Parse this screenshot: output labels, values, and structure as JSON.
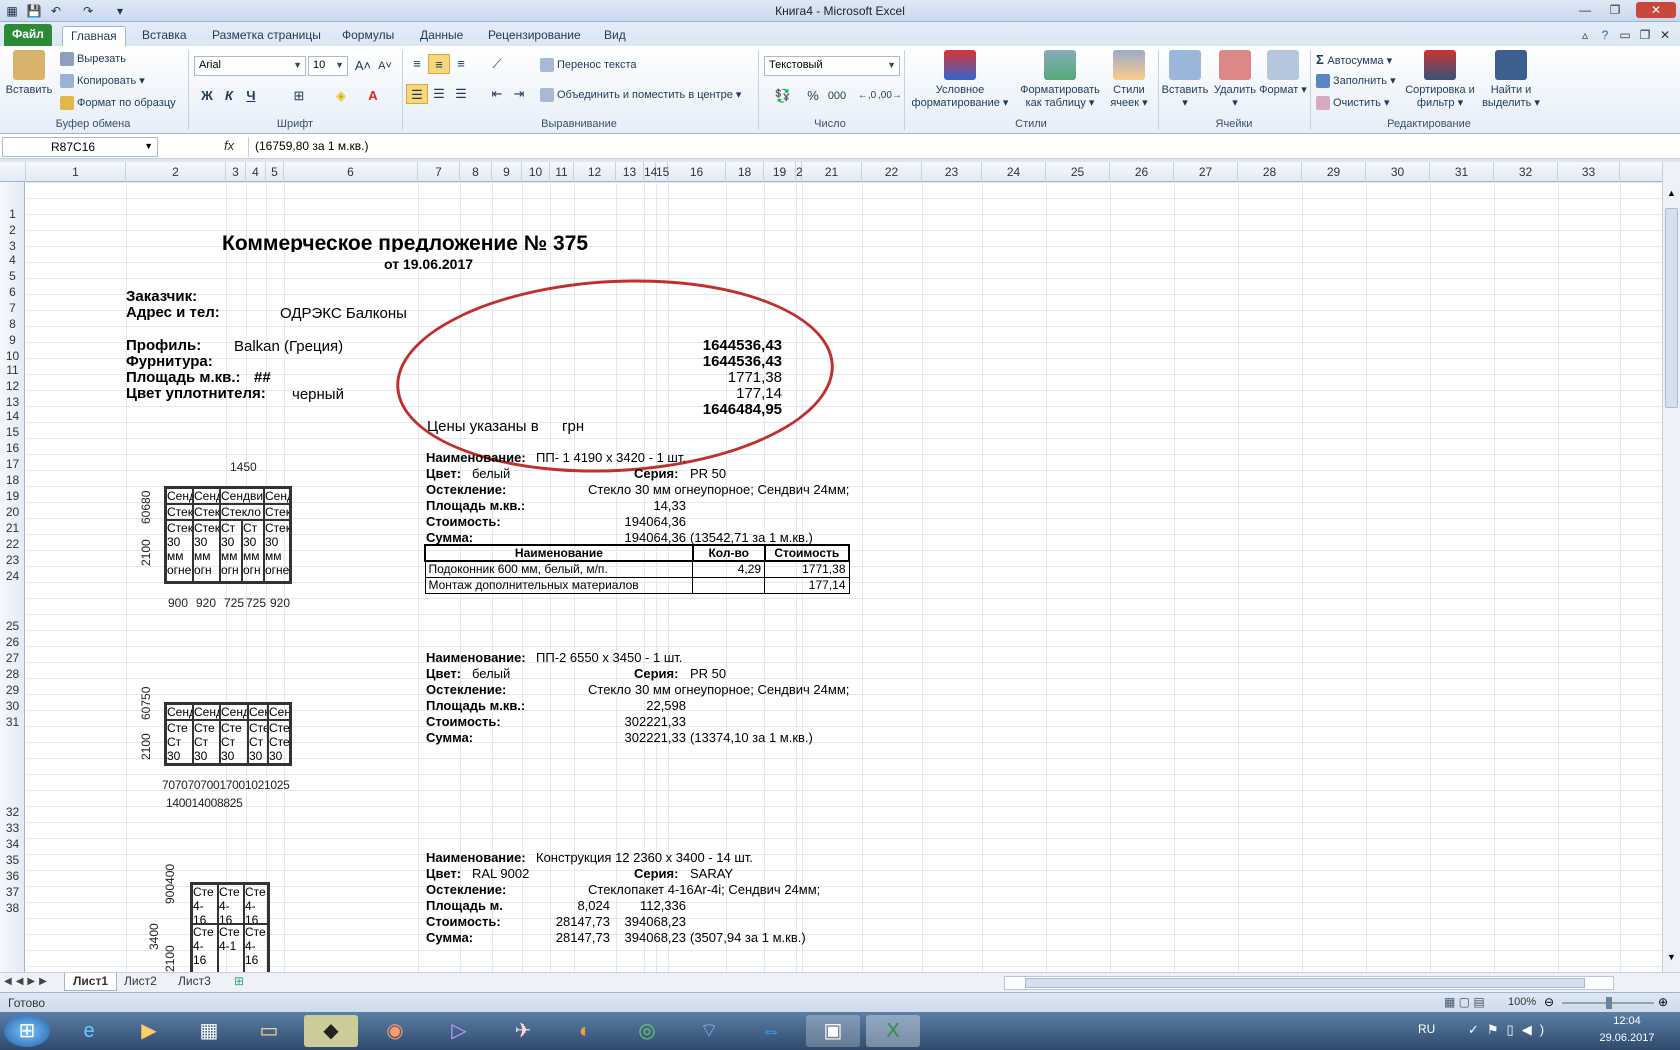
{
  "window": {
    "title": "Книга4  -  Microsoft Excel",
    "qat": [
      "save-icon",
      "undo-icon",
      "redo-icon",
      "customize-icon"
    ]
  },
  "tabs": [
    "Файл",
    "Главная",
    "Вставка",
    "Разметка страницы",
    "Формулы",
    "Данные",
    "Рецензирование",
    "Вид"
  ],
  "ribbon": {
    "clipboard": {
      "paste": "Вставить",
      "cut": "Вырезать",
      "copy": "Копировать",
      "format_painter": "Формат по образцу",
      "label": "Буфер обмена"
    },
    "font": {
      "name": "Arial",
      "size": "10",
      "label": "Шрифт",
      "bold": "Ж",
      "italic": "К",
      "underline": "Ч"
    },
    "alignment": {
      "wrap": "Перенос текста",
      "merge": "Объединить и поместить в центре",
      "label": "Выравнивание"
    },
    "number": {
      "format": "Текстовый",
      "label": "Число",
      "percent": "%",
      "thousands": "000"
    },
    "styles": {
      "cond": "Условное форматирование",
      "table": "Форматировать как таблицу",
      "cell": "Стили ячеек",
      "label": "Стили"
    },
    "cells": {
      "insert": "Вставить",
      "delete": "Удалить",
      "format": "Формат",
      "label": "Ячейки"
    },
    "editing": {
      "autosum": "Автосумма",
      "fill": "Заполнить",
      "clear": "Очистить",
      "sort": "Сортировка и фильтр",
      "find": "Найти и выделить",
      "label": "Редактирование"
    }
  },
  "formula_bar": {
    "name_box": "R87C16",
    "fx": "fx",
    "formula": "(16759,80 за 1 м.кв.)"
  },
  "columns": [
    "1",
    "2",
    "3",
    "4",
    "5",
    "6",
    "7",
    "8",
    "9",
    "10",
    "11",
    "12",
    "13",
    "14",
    "15",
    "16",
    "18",
    "19",
    "2",
    "21",
    "22",
    "23",
    "24",
    "25",
    "26",
    "27",
    "28",
    "29",
    "30",
    "31",
    "32",
    "33"
  ],
  "rows": [
    "1",
    "2",
    "3",
    "4",
    "5",
    "6",
    "7",
    "8",
    "9",
    "10",
    "11",
    "12",
    "13",
    "14",
    "15",
    "16",
    "17",
    "18",
    "19",
    "20",
    "21",
    "22",
    "23",
    "24",
    "25",
    "26",
    "27",
    "28",
    "29",
    "30",
    "31",
    "32",
    "33",
    "34",
    "35",
    "36",
    "37",
    "38"
  ],
  "doc": {
    "title": "Коммерческое предложение № 375",
    "date": "от 19.06.2017",
    "customer_label": "Заказчик:",
    "address_label": "Адрес и тел:",
    "address_value": "ОДРЭКС  Балконы",
    "profile_label": "Профиль:",
    "profile_value": "Balkan (Греция)",
    "hardware_label": "Фурнитура:",
    "area_label": "Площадь м.кв.:",
    "area_value": "##",
    "seal_label": "Цвет уплотнителя:",
    "seal_value": "черный",
    "totals": [
      "1644536,43",
      "1644536,43",
      "1771,38",
      "177,14",
      "1646484,95"
    ],
    "currency_label": "Цены указаны в",
    "currency_value": "грн"
  },
  "items": [
    {
      "name_label": "Наименование:",
      "name": "ПП- 1 4190 x 3420 - 1 шт.",
      "color_label": "Цвет:",
      "color": "белый",
      "series_label": "Серия:",
      "series": "PR 50",
      "glazing_label": "Остекление:",
      "glazing": "Стекло 30 мм огнеупорное; Сендвич 24мм;",
      "area_label": "Площадь м.кв.:",
      "area": "14,33",
      "cost_label": "Стоимость:",
      "cost": "194064,36",
      "sum_label": "Сумма:",
      "sum": "194064,36",
      "per_m2": "(13542,71 за 1 м.кв.)",
      "dims_top": "1450",
      "dims_left": [
        "60680",
        "2100"
      ],
      "dims_bottom": [
        "900",
        "920",
        "725",
        "725",
        "920"
      ]
    },
    {
      "name_label": "Наименование:",
      "name": "ПП-2 6550 x 3450 - 1 шт.",
      "color_label": "Цвет:",
      "color": "белый",
      "series_label": "Серия:",
      "series": "PR 50",
      "glazing_label": "Остекление:",
      "glazing": "Стекло 30 мм огнеупорное; Сендвич 24мм;",
      "area_label": "Площадь м.кв.:",
      "area": "22,598",
      "cost_label": "Стоимость:",
      "cost": "302221,33",
      "sum_label": "Сумма:",
      "sum": "302221,33",
      "per_m2": "(13374,10 за 1 м.кв.)",
      "dims_left": [
        "60750",
        "2100"
      ],
      "dims_bottom": [
        "70707070017001021025",
        "140014008825"
      ]
    },
    {
      "name_label": "Наименование:",
      "name": "Конструкция 12 2360 x 3400 - 14 шт.",
      "color_label": "Цвет:",
      "color": "RAL 9002",
      "series_label": "Серия:",
      "series": "SARAY",
      "glazing_label": "Остекление:",
      "glazing": "Стеклопакет 4-16Ar-4i; Сендвич 24мм;",
      "area_label": "Площадь м.",
      "area_unit": "8,024",
      "area": "112,336",
      "cost_label": "Стоимость:",
      "cost_unit": "28147,73",
      "cost": "394068,23",
      "sum_label": "Сумма:",
      "sum_unit": "28147,73",
      "sum": "394068,23",
      "per_m2": "(3507,94 за 1 м.кв.)",
      "dims_left": [
        "900400",
        "3400",
        "2100"
      ]
    }
  ],
  "materials": {
    "headers": [
      "Наименование",
      "Кол-во",
      "Стоимость"
    ],
    "rows": [
      [
        "Подоконник 600 мм, белый, м/п.",
        "4,29",
        "1771,38"
      ],
      [
        "Монтаж дополнительных материалов",
        "",
        "177,14"
      ]
    ]
  },
  "sheet_tabs": [
    "Лист1",
    "Лист2",
    "Лист3"
  ],
  "status": {
    "ready": "Готово",
    "zoom": "100%"
  },
  "taskbar": {
    "lang": "RU",
    "time": "12:04",
    "date": "29.06.2017"
  },
  "colors": {
    "file_tab": "#2a8a36",
    "annotation": "#c0302c",
    "ribbon_text": "#1e395b"
  }
}
